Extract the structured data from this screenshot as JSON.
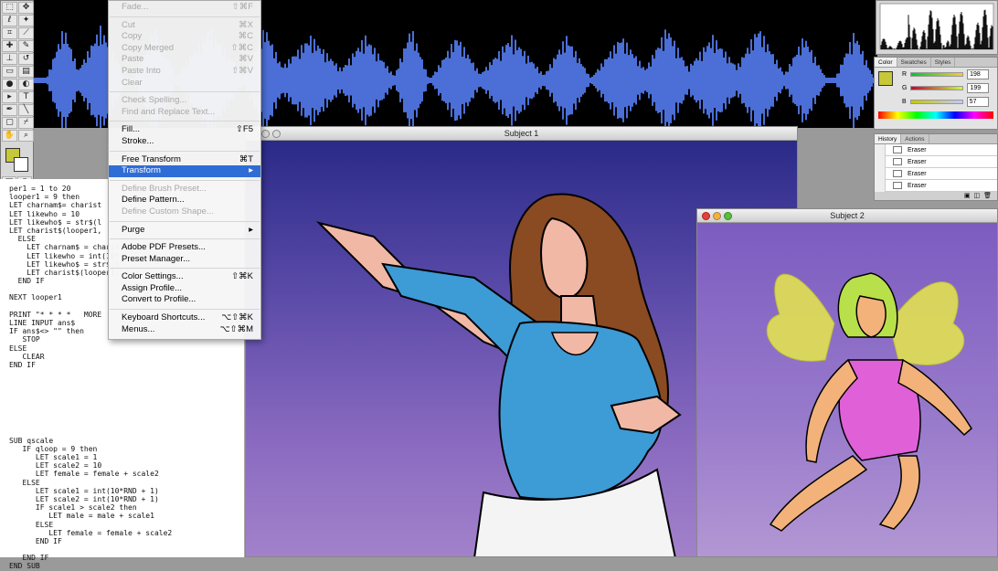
{
  "code_lines": [
    "per1 = 1 to 20",
    "looper1 = 9 then",
    "LET charnam$= charist",
    "LET likewho = 10",
    "LET likewho$ = str$(l",
    "LET charist$(looper1,",
    "  ELSE",
    "    LET charnam$ = charis",
    "    LET likewho = int(10*",
    "    LET likewho$ = str$(l",
    "    LET charist$(looper1,",
    "  END IF",
    "",
    "NEXT looper1",
    "",
    "PRINT \"* * * *   MORE    * *",
    "LINE INPUT ans$",
    "IF ans$<> \"\" then",
    "   STOP",
    "ELSE",
    "   CLEAR",
    "END IF",
    "",
    "",
    "",
    "",
    "",
    "",
    "",
    "",
    "SUB qscale",
    "   IF qloop = 9 then",
    "      LET scale1 = 1",
    "      LET scale2 = 10",
    "      LET female = female + scale2",
    "   ELSE",
    "      LET scale1 = int(10*RND + 1)",
    "      LET scale2 = int(10*RND + 1)",
    "      IF scale1 > scale2 then",
    "         LET male = male + scale1",
    "      ELSE",
    "         LET female = female + scale2",
    "      END IF",
    "",
    "   END IF",
    "END SUB"
  ],
  "menu": [
    {
      "label": "Fade...",
      "shortcut": "⇧⌘F",
      "enabled": false
    },
    {
      "sep": true
    },
    {
      "label": "Cut",
      "shortcut": "⌘X",
      "enabled": false
    },
    {
      "label": "Copy",
      "shortcut": "⌘C",
      "enabled": false
    },
    {
      "label": "Copy Merged",
      "shortcut": "⇧⌘C",
      "enabled": false
    },
    {
      "label": "Paste",
      "shortcut": "⌘V",
      "enabled": false
    },
    {
      "label": "Paste Into",
      "shortcut": "⇧⌘V",
      "enabled": false
    },
    {
      "label": "Clear",
      "shortcut": "",
      "enabled": false
    },
    {
      "sep": true
    },
    {
      "label": "Check Spelling...",
      "shortcut": "",
      "enabled": false
    },
    {
      "label": "Find and Replace Text...",
      "shortcut": "",
      "enabled": false
    },
    {
      "sep": true
    },
    {
      "label": "Fill...",
      "shortcut": "⇧F5",
      "enabled": true
    },
    {
      "label": "Stroke...",
      "shortcut": "",
      "enabled": true
    },
    {
      "sep": true
    },
    {
      "label": "Free Transform",
      "shortcut": "⌘T",
      "enabled": true
    },
    {
      "label": "Transform",
      "shortcut": "▸",
      "enabled": true,
      "selected": true
    },
    {
      "sep": true
    },
    {
      "label": "Define Brush Preset...",
      "shortcut": "",
      "enabled": false
    },
    {
      "label": "Define Pattern...",
      "shortcut": "",
      "enabled": true
    },
    {
      "label": "Define Custom Shape...",
      "shortcut": "",
      "enabled": false
    },
    {
      "sep": true
    },
    {
      "label": "Purge",
      "shortcut": "▸",
      "enabled": true
    },
    {
      "sep": true
    },
    {
      "label": "Adobe PDF Presets...",
      "shortcut": "",
      "enabled": true
    },
    {
      "label": "Preset Manager...",
      "shortcut": "",
      "enabled": true
    },
    {
      "sep": true
    },
    {
      "label": "Color Settings...",
      "shortcut": "⇧⌘K",
      "enabled": true
    },
    {
      "label": "Assign Profile...",
      "shortcut": "",
      "enabled": true
    },
    {
      "label": "Convert to Profile...",
      "shortcut": "",
      "enabled": true
    },
    {
      "sep": true
    },
    {
      "label": "Keyboard Shortcuts...",
      "shortcut": "⌥⇧⌘K",
      "enabled": true
    },
    {
      "label": "Menus...",
      "shortcut": "⌥⇧⌘M",
      "enabled": true
    }
  ],
  "windows": {
    "subject1": {
      "title": "Subject 1"
    },
    "subject2": {
      "title": "Subject 2"
    }
  },
  "color_panel": {
    "tabs": [
      "Color",
      "Swatches",
      "Styles"
    ],
    "channels": [
      {
        "label": "R",
        "value": "198"
      },
      {
        "label": "G",
        "value": "199"
      },
      {
        "label": "B",
        "value": "57"
      }
    ],
    "foreground": "#c6c739"
  },
  "history_panel": {
    "tabs": [
      "History",
      "Actions"
    ],
    "items": [
      "Eraser",
      "Eraser",
      "Eraser",
      "Eraser"
    ]
  },
  "colors": {
    "wave": "#4b6fd6",
    "menu_highlight": "#2f6dd6"
  }
}
